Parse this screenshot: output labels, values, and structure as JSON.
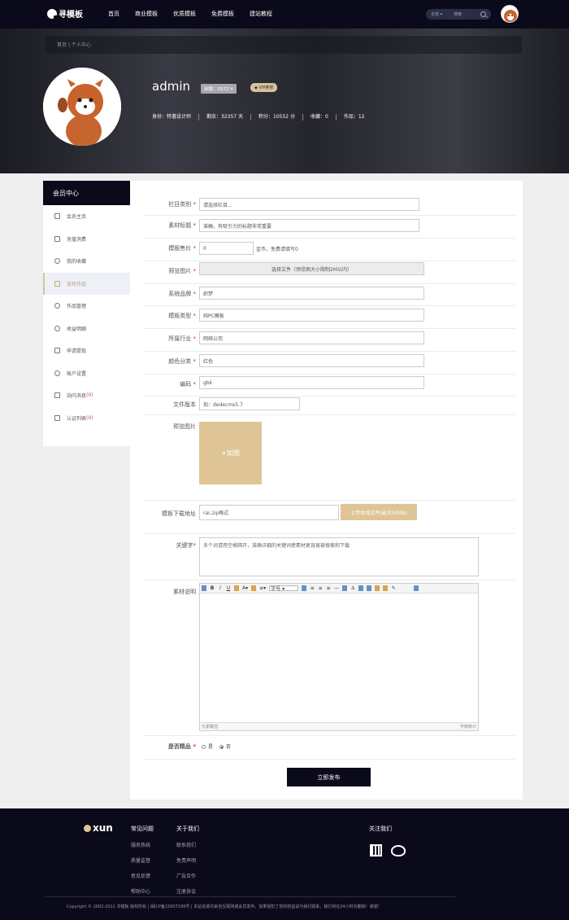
{
  "header": {
    "logo_text": "寻模板",
    "nav": [
      "首页",
      "商业模板",
      "优质模板",
      "免费模板",
      "建站教程"
    ],
    "search": {
      "category": "全部",
      "placeholder": "搜索"
    }
  },
  "profile": {
    "breadcrumb": {
      "home": "首页",
      "sep": "\\",
      "current": "个人中心"
    },
    "username": "admin",
    "balance": "余额：5572 ¥",
    "vip": "VIP荣誉",
    "stats": [
      "身份：特邀设计师",
      "剩余：32357 天",
      "积分：10552 分",
      "收藏：0",
      "作品：12"
    ]
  },
  "sidebar": {
    "title": "会员中心",
    "items": [
      {
        "label": "会员主页",
        "icon": "home-icon"
      },
      {
        "label": "充值消费",
        "icon": "wallet-icon"
      },
      {
        "label": "我的收藏",
        "icon": "star-icon"
      },
      {
        "label": "发布作品",
        "icon": "document-icon"
      },
      {
        "label": "作品管理",
        "icon": "check-circle-icon"
      },
      {
        "label": "收益明细",
        "icon": "coin-icon"
      },
      {
        "label": "申请提现",
        "icon": "card-icon"
      },
      {
        "label": "账户设置",
        "icon": "gear-icon"
      },
      {
        "label": "站内消息",
        "icon": "mail-icon",
        "badge": "(0)"
      },
      {
        "label": "认证列表",
        "icon": "shield-icon",
        "badge": "(0)"
      }
    ]
  },
  "form": {
    "category": {
      "label": "栏目类别",
      "value": "请选择栏目..."
    },
    "title": {
      "label": "素材标题",
      "value": "准确，有吸引力的标题非常重要"
    },
    "price": {
      "label": "模板售价",
      "value": "0",
      "unit": "金币，免费请填写0"
    },
    "preview_file": {
      "label": "预览图片",
      "button": "选择文件（预览图大小限制2M以内）"
    },
    "brand": {
      "label": "系统品牌",
      "value": "织梦"
    },
    "type": {
      "label": "模板类型",
      "value": "纯PC模板"
    },
    "industry": {
      "label": "所属行业",
      "value": "网络公司"
    },
    "color": {
      "label": "颜色分类",
      "value": "红色"
    },
    "encoding": {
      "label": "编码",
      "value": "gbk"
    },
    "version": {
      "label": "文件版本",
      "placeholder": "如：dedecms5.7"
    },
    "preview_image": {
      "label": "预览图片",
      "add": "+加图"
    },
    "download": {
      "label": "模板下载地址",
      "placeholder": "rar,zip格式",
      "upload": "上传本地文件(最大50MB)"
    },
    "keywords": {
      "label": "关键字",
      "placeholder": "多个词请用空格隔开，准确详细的关键词使素材更容易被搜索和下载"
    },
    "description": {
      "label": "素材说明",
      "path_label": "元素路径:",
      "word_count": "字数统计",
      "font_select": "字号"
    },
    "featured": {
      "label": "是否精品",
      "options": [
        "是",
        "否"
      ],
      "selected": "否"
    },
    "submit": "立即发布"
  },
  "footer": {
    "logo": "xun",
    "faq": {
      "title": "常见问题",
      "items": [
        "服务热线",
        "质量监督",
        "意见反馈",
        "帮助中心"
      ]
    },
    "about": {
      "title": "关于我们",
      "items": [
        "联系我们",
        "免责声明",
        "广告合作",
        "注册协议"
      ]
    },
    "follow": "关注我们",
    "copyright": "Copyright © 2002-2011 寻模板 版权所有 | 闽ICP备15007199号  |  本站资源均来自互联网或会员发布，如果侵犯了您的权益请与我们联系，我们将在24小时内删除！谢谢！"
  }
}
